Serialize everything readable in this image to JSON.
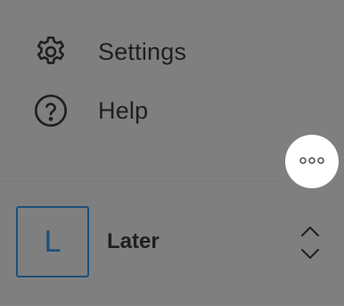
{
  "menu": {
    "items": [
      {
        "label": "Settings",
        "icon": "gear-icon"
      },
      {
        "label": "Help",
        "icon": "help-circle-icon"
      }
    ]
  },
  "more_button": {
    "icon": "ellipsis-icon"
  },
  "account": {
    "avatar_letter": "L",
    "name": "Later",
    "switcher_icon": "chevron-up-down-icon"
  },
  "colors": {
    "overlay_background": "#7f7f7f",
    "text": "#1f1f1f",
    "avatar_accent": "#1d4f79",
    "more_button_bg": "#ffffff"
  }
}
